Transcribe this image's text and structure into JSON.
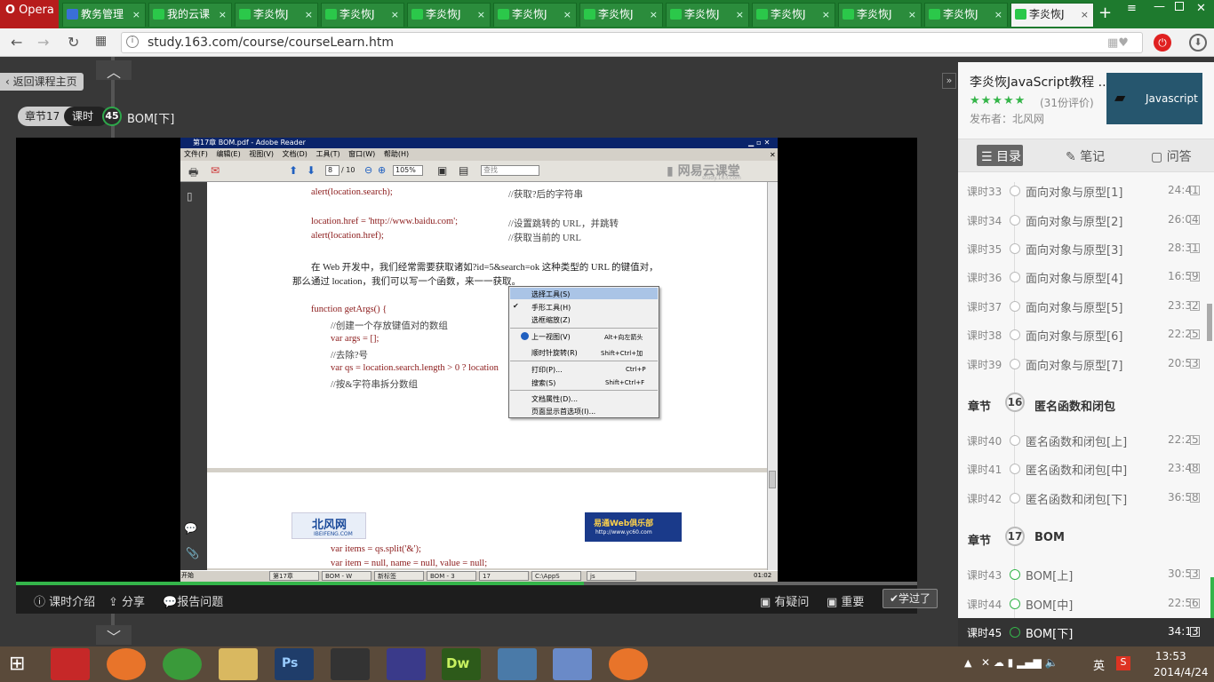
{
  "browser": {
    "opera_label": "Opera",
    "tabs": [
      {
        "label": "教务管理"
      },
      {
        "label": "我的云课"
      },
      {
        "label": "李炎恢J"
      },
      {
        "label": "李炎恢J"
      },
      {
        "label": "李炎恢J"
      },
      {
        "label": "李炎恢J"
      },
      {
        "label": "李炎恢J"
      },
      {
        "label": "李炎恢J"
      },
      {
        "label": "李炎恢J"
      },
      {
        "label": "李炎恢J"
      },
      {
        "label": "李炎恢J"
      },
      {
        "label": "李炎恢J"
      }
    ],
    "tab_close": "×",
    "new_tab": "+",
    "url": "study.163.com/course/courseLearn.htm"
  },
  "player": {
    "back_home": "返回课程主页",
    "chapter_label": "章节17",
    "lesson_label": "课时",
    "lesson_number": "45",
    "lesson_title": "BOM[下]",
    "progress_fraction": 0.63,
    "controls": {
      "intro": "课时介绍",
      "share": "分享",
      "report": "报告问题",
      "question": "有疑问",
      "important": "重要",
      "learned": "学过了"
    }
  },
  "pdf": {
    "title": "第17章 BOM.pdf - Adobe Reader",
    "menu": [
      "文件(F)",
      "编辑(E)",
      "视图(V)",
      "文档(D)",
      "工具(T)",
      "窗口(W)",
      "帮助(H)"
    ],
    "page_current": "8",
    "page_total": "/ 10",
    "zoom": "105%",
    "search_placeholder": "查找",
    "watermark": "网易云课堂",
    "watermark_sub": "study.163.com",
    "lines": {
      "l1_code": "alert(location.search);",
      "l1_cmt": "//获取?后的字符串",
      "l2_code": "location.href = 'http://www.baidu.com';",
      "l2_cmt": "//设置跳转的 URL，并跳转",
      "l3_code": "alert(location.href);",
      "l3_cmt": "//获取当前的 URL",
      "p1": "在 Web 开发中，我们经常需要获取诸如?id=5&search=ok 这种类型的 URL 的键值对，",
      "p2": "那么通过 location，我们可以写一个函数，来一一获取。",
      "f1": "function getArgs() {",
      "f2": "//创建一个存放键值对的数组",
      "f3": "var args = [];",
      "f4": "//去除?号",
      "f5": "var qs = location.search.length > 0 ? location",
      "f6": "//按&字符串拆分数组",
      "f7": "var items = qs.split('&');",
      "f8": "var item = null, name = null, value = null;"
    },
    "logo_left": "北风网",
    "logo_left_sub": "IBEIFENG.COM",
    "logo_right": "易通Web俱乐部",
    "logo_right_sub": "http://www.yc60.com",
    "context_menu": [
      {
        "label": "选择工具(S)",
        "shortcut": ""
      },
      {
        "label": "手形工具(H)",
        "shortcut": ""
      },
      {
        "label": "选框缩放(Z)",
        "shortcut": ""
      },
      {
        "label": "上一视图(V)",
        "shortcut": "Alt+向左箭头"
      },
      {
        "label": "顺时针旋转(R)",
        "shortcut": "Shift+Ctrl+加"
      },
      {
        "label": "打印(P)...",
        "shortcut": "Ctrl+P"
      },
      {
        "label": "搜索(S)",
        "shortcut": "Shift+Ctrl+F"
      },
      {
        "label": "文档属性(D)...",
        "shortcut": ""
      },
      {
        "label": "页面显示首选项(I)...",
        "shortcut": ""
      }
    ],
    "taskbar": {
      "start": "开始",
      "items": [
        "第17章",
        "BOM - W",
        "新标签",
        "BOM - 3",
        "17",
        "C:\\AppS",
        "js"
      ],
      "time": "01:02"
    }
  },
  "panel": {
    "course_title": "李炎恢JavaScript教程 ...",
    "stars": "★★★★★",
    "rating": "(31份评价)",
    "publisher": "发布者：北风网",
    "thumb_text": "Javascript",
    "tabs": {
      "toc": "目录",
      "notes": "笔记",
      "qa": "问答"
    },
    "lessons_a": [
      {
        "num": "课时33",
        "title": "面向对象与原型[1]",
        "dur": "24:41"
      },
      {
        "num": "课时34",
        "title": "面向对象与原型[2]",
        "dur": "26:04"
      },
      {
        "num": "课时35",
        "title": "面向对象与原型[3]",
        "dur": "28:31"
      },
      {
        "num": "课时36",
        "title": "面向对象与原型[4]",
        "dur": "16:59"
      },
      {
        "num": "课时37",
        "title": "面向对象与原型[5]",
        "dur": "23:32"
      },
      {
        "num": "课时38",
        "title": "面向对象与原型[6]",
        "dur": "22:25"
      },
      {
        "num": "课时39",
        "title": "面向对象与原型[7]",
        "dur": "20:53"
      }
    ],
    "chapter16": {
      "label": "章节",
      "num": "16",
      "title": "匿名函数和闭包"
    },
    "lessons_b": [
      {
        "num": "课时40",
        "title": "匿名函数和闭包[上]",
        "dur": "22:25"
      },
      {
        "num": "课时41",
        "title": "匿名函数和闭包[中]",
        "dur": "23:48"
      },
      {
        "num": "课时42",
        "title": "匿名函数和闭包[下]",
        "dur": "36:58"
      }
    ],
    "chapter17": {
      "label": "章节",
      "num": "17",
      "title": "BOM"
    },
    "lessons_c": [
      {
        "num": "课时43",
        "title": "BOM[上]",
        "dur": "30:53"
      },
      {
        "num": "课时44",
        "title": "BOM[中]",
        "dur": "22:56"
      },
      {
        "num": "课时45",
        "title": "BOM[下]",
        "dur": "34:13"
      }
    ]
  },
  "taskbar": {
    "time": "13:53",
    "date": "2014/4/24",
    "ime": "英"
  }
}
